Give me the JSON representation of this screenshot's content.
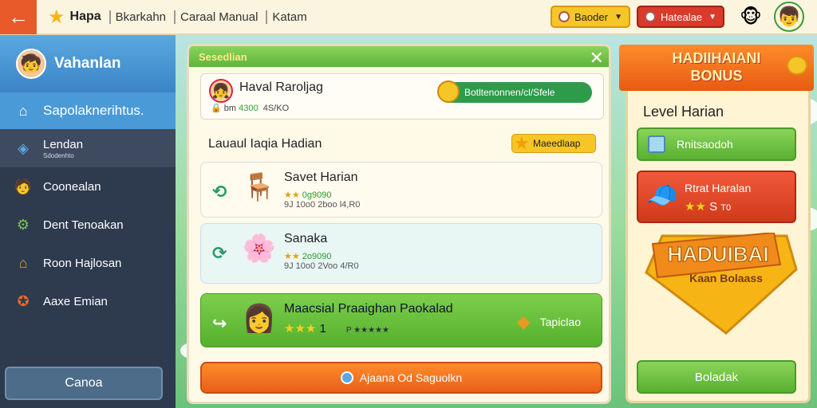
{
  "topbar": {
    "back_icon": "arrow-left-icon",
    "title": "Hapa",
    "crumbs": [
      "Bkarkahn",
      "Caraal",
      "Manual",
      "Katam"
    ],
    "pill1_label": "Baoder",
    "pill2_label": "Hatealae"
  },
  "sidebar": {
    "username": "Vahanlan",
    "items": [
      {
        "label": "Sapolaknerihtus.",
        "icon": "house-icon"
      },
      {
        "label": "Lendan",
        "sub": "Sdodenhto",
        "icon": "shield-icon"
      },
      {
        "label": "Coonealan",
        "icon": "character-icon"
      },
      {
        "label": "Dent Tenoakan",
        "icon": "gear-icon"
      },
      {
        "label": "Roon Hajlosan",
        "icon": "home-icon"
      },
      {
        "label": "Aaxe Emian",
        "icon": "medal-icon"
      }
    ],
    "button_label": "Canoa"
  },
  "main": {
    "header_label": "Sesedlian",
    "profile": {
      "name": "Haval Raroljag",
      "stats_prefix": "bm",
      "stats_value": "4300",
      "stats_suffix": "4S/KO",
      "button_label": "Botltenonnen/cl/Sfele"
    },
    "section_title": "Lauaul Iaqia Hadian",
    "section_badge": "Maeedlaap",
    "cards": [
      {
        "name": "Savet Harian",
        "stars": "★★",
        "score": "0g9090",
        "meta": "9J 10o0 2boo   l4,R0"
      },
      {
        "name": "Sanaka",
        "stars": "★★",
        "score": "2o9090",
        "meta": "9J 10o0 2Voo   4/R0"
      },
      {
        "name": "Maacsial Praaighan Paokalad",
        "stars": "★★★",
        "level": "1",
        "small": "P  ★★★★★",
        "badge": "Tapiclao"
      }
    ],
    "action_label": "Ajaana Od Saguolkn"
  },
  "right": {
    "banner_line1": "HADIIHAIANI",
    "banner_line2": "BONUS",
    "level_title": "Level Harian",
    "btn1_label": "Rnitsaodoh",
    "btn2_title": "Rtrat Haralan",
    "btn2_stars": "★★",
    "btn2_num": "S",
    "btn2_tail": "T0",
    "ribbon_line1": "HADUIBAI",
    "ribbon_line2": "Kaan Bolaass",
    "bottom_btn": "Boladak"
  },
  "colors": {
    "accent_green": "#5fb33c",
    "accent_orange": "#e8601a",
    "sidebar_bg": "#2e3a4e",
    "header_blue": "#4b9ad8"
  }
}
